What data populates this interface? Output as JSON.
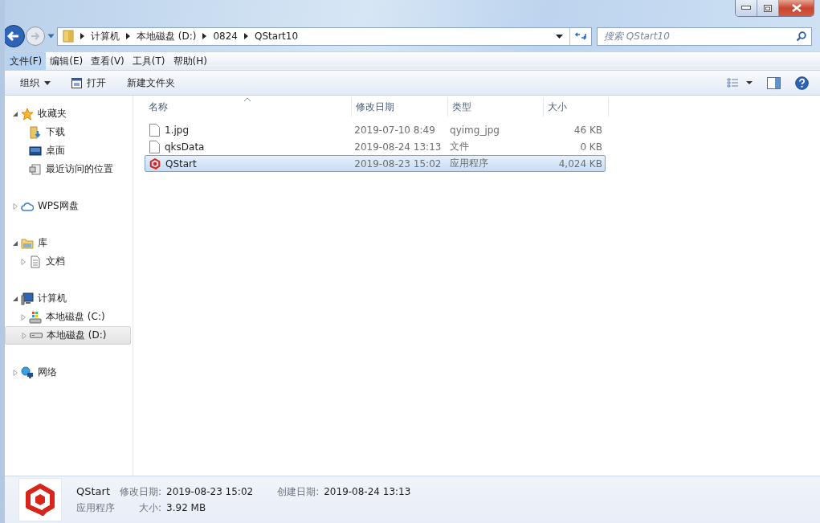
{
  "address": {
    "crumbs": [
      "计算机",
      "本地磁盘 (D:)",
      "0824",
      "QStart10"
    ]
  },
  "search": {
    "placeholder": "搜索 QStart10"
  },
  "menu": [
    {
      "label": "文件(F)",
      "selected": true
    },
    {
      "label": "编辑(E)",
      "selected": false
    },
    {
      "label": "查看(V)",
      "selected": false
    },
    {
      "label": "工具(T)",
      "selected": false
    },
    {
      "label": "帮助(H)",
      "selected": false
    }
  ],
  "toolbar": [
    {
      "label": "组织",
      "kind": "dropdown"
    },
    {
      "label": "打开",
      "kind": "open"
    },
    {
      "label": "新建文件夹",
      "kind": "plain"
    }
  ],
  "sidebar": [
    {
      "label": "收藏夹",
      "kind": "star",
      "expanded": true,
      "selected": false,
      "children": [
        {
          "label": "下载",
          "kind": "download",
          "selected": false
        },
        {
          "label": "桌面",
          "kind": "desktop",
          "selected": false
        },
        {
          "label": "最近访问的位置",
          "kind": "recent",
          "selected": false
        }
      ]
    },
    {
      "label": "WPS网盘",
      "kind": "cloud",
      "expanded": false,
      "selected": false
    },
    {
      "label": "库",
      "kind": "library",
      "expanded": true,
      "selected": false,
      "children": [
        {
          "label": "文档",
          "kind": "document",
          "expanded": false,
          "selected": false
        }
      ]
    },
    {
      "label": "计算机",
      "kind": "computer",
      "expanded": true,
      "selected": false,
      "children": [
        {
          "label": "本地磁盘 (C:)",
          "kind": "sysdrive",
          "expanded": false,
          "selected": false
        },
        {
          "label": "本地磁盘 (D:)",
          "kind": "drive",
          "expanded": false,
          "selected": true
        }
      ]
    },
    {
      "label": "网络",
      "kind": "network",
      "expanded": false,
      "selected": false
    }
  ],
  "table": {
    "columns": [
      "名称",
      "修改日期",
      "类型",
      "大小"
    ],
    "rows": [
      {
        "name": "1.jpg",
        "date": "2019-07-10 8:49",
        "type": "qyimg_jpg",
        "size": "46 KB",
        "kind": "file",
        "selected": false
      },
      {
        "name": "qksData",
        "date": "2019-08-24 13:13",
        "type": "文件",
        "size": "0 KB",
        "kind": "file",
        "selected": false
      },
      {
        "name": "QStart",
        "date": "2019-08-23 15:02",
        "type": "应用程序",
        "size": "4,024 KB",
        "kind": "app",
        "selected": true
      }
    ]
  },
  "details": {
    "name": "QStart",
    "type": "应用程序",
    "modified_label": "修改日期:",
    "modified": "2019-08-23 15:02",
    "created_label": "创建日期:",
    "created": "2019-08-24 13:13",
    "size_label": "大小:",
    "size": "3.92 MB"
  }
}
